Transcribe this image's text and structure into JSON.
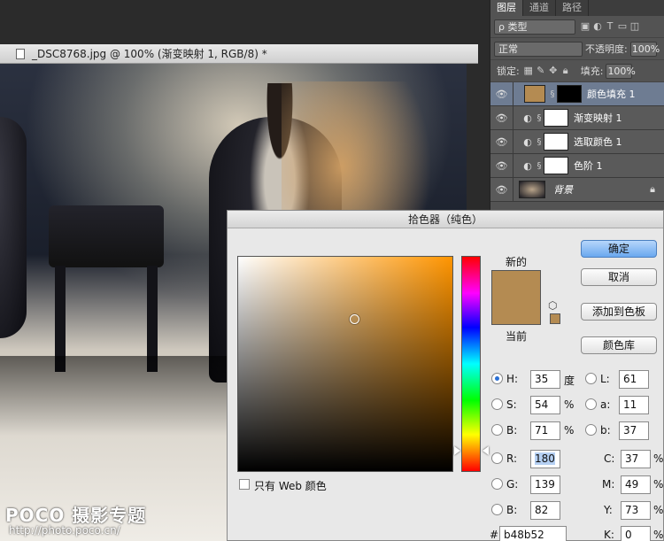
{
  "document": {
    "title": "_DSC8768.jpg @ 100% (渐变映射 1, RGB/8) *"
  },
  "watermark": {
    "logo": "POCO 摄影专题",
    "url": "http://photo.poco.cn/"
  },
  "layers_panel": {
    "tabs": [
      "图层",
      "通道",
      "路径"
    ],
    "kind_filter": "ρ 类型",
    "blend_mode": "正常",
    "opacity_label": "不透明度:",
    "opacity_value": "100%",
    "lock_label": "锁定:",
    "fill_label": "填充:",
    "fill_value": "100%",
    "layers": [
      {
        "name": "颜色填充 1",
        "thumb_color": "#b48b52"
      },
      {
        "name": "渐变映射 1"
      },
      {
        "name": "选取颜色 1"
      },
      {
        "name": "色阶 1"
      },
      {
        "name": "背景"
      }
    ]
  },
  "color_picker": {
    "title": "拾色器（纯色）",
    "new_label": "新的",
    "current_label": "当前",
    "new_color": "#b48b52",
    "current_color": "#b48b52",
    "buttons": {
      "ok": "确定",
      "cancel": "取消",
      "add_to_swatches": "添加到色板",
      "color_libraries": "颜色库"
    },
    "hsb": {
      "h_label": "H:",
      "h": "35",
      "h_unit": "度",
      "s_label": "S:",
      "s": "54",
      "s_unit": "%",
      "b_label": "B:",
      "b": "71",
      "b_unit": "%"
    },
    "rgb": {
      "r_label": "R:",
      "r": "180",
      "g_label": "G:",
      "g": "139",
      "b_label": "B:",
      "b": "82"
    },
    "lab": {
      "l_label": "L:",
      "l": "61",
      "a_label": "a:",
      "a": "11",
      "b_label": "b:",
      "b": "37"
    },
    "cmyk": {
      "c_label": "C:",
      "c": "37",
      "m_label": "M:",
      "m": "49",
      "y_label": "Y:",
      "y": "73",
      "k_label": "K:",
      "k": "0",
      "unit": "%"
    },
    "hex_label": "#",
    "hex": "b48b52",
    "web_only_label": "只有 Web 颜色",
    "field_saturation": 0.54,
    "field_brightness": 0.71,
    "hue_degrees": 35
  }
}
